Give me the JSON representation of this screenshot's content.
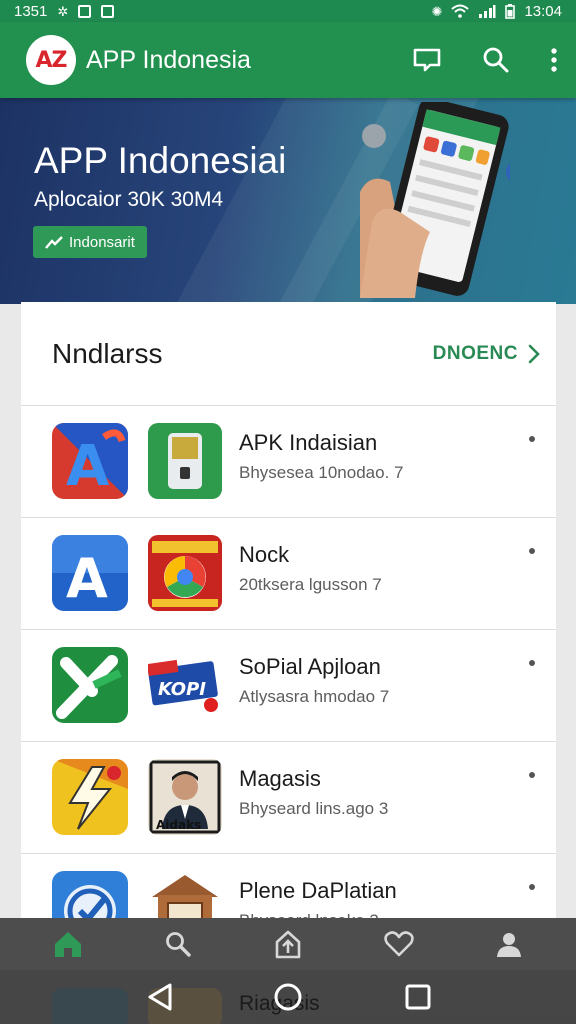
{
  "status_bar": {
    "time_left": "1351",
    "time_right": "13:04"
  },
  "app_bar": {
    "logo_text": "AZ",
    "title": "APP Indonesia",
    "icons": [
      "chat-bubble-icon",
      "search-icon",
      "more-vert-icon"
    ]
  },
  "banner": {
    "title": "APP Indonesiai",
    "subtitle": "Aplocaior 30K 30M4",
    "button_label": "Indonsarit"
  },
  "section": {
    "title": "Nndlarss",
    "more_label": "DNOENC"
  },
  "apps": [
    {
      "name": "APK Indaisian",
      "meta": "Bhysesea 10nodao.  7",
      "icon1": "a-letter-red-icon",
      "icon2": "green-lock-app-icon"
    },
    {
      "name": "Nock",
      "meta": "20tksera lgusson  7",
      "icon1": "a-letter-blue-icon",
      "icon2": "chrome-badge-icon"
    },
    {
      "name": "SoPial Apjloan",
      "meta": "Atlysasra hmodao  7",
      "icon1": "green-x-icon",
      "icon2": "kopi-sticker-icon",
      "icon2_text": "KOPI"
    },
    {
      "name": "Magasis",
      "meta": "Bhyseard lins.ago  3",
      "icon1": "yellow-bolt-icon",
      "icon2": "portrait-icon",
      "icon2_text": "Aidaks"
    },
    {
      "name": "Plene DaPlatian",
      "meta": "Bhyseard lnsako  3",
      "icon1": "blue-check-icon",
      "icon2": "wooden-door-icon"
    }
  ],
  "peek_item": {
    "name": "Riagasis"
  },
  "bottom_nav": [
    "home-icon",
    "search-icon",
    "upload-icon",
    "heart-icon",
    "profile-icon"
  ],
  "system_nav": [
    "back-icon",
    "home-circle-icon",
    "recents-icon"
  ],
  "colors": {
    "primary": "#22904f",
    "status_bar": "#1f8a4f",
    "accent_text": "#2a8a55",
    "bottom_nav": "#4d4d4d"
  }
}
